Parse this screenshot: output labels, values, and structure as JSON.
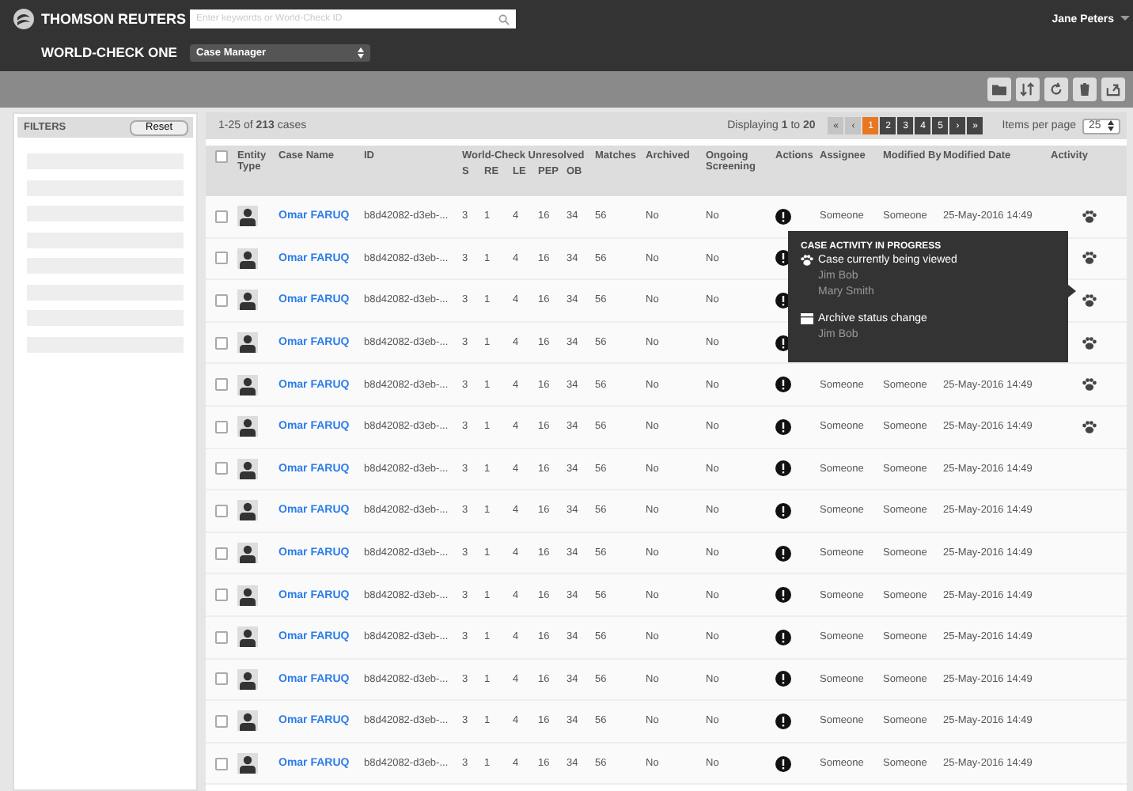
{
  "header": {
    "brand": "THOMSON REUTERS",
    "product": "WORLD-CHECK ONE",
    "search": {
      "placeholder": "Enter keywords or World-Check ID"
    },
    "module_select": "Case Manager",
    "user": "Jane Peters"
  },
  "filters": {
    "title": "FILTERS",
    "reset": "Reset"
  },
  "cases": {
    "summary": "1-25 of **213** cases",
    "displaying": "Displaying **1** to **20**",
    "pagination": [
      {
        "label": "«",
        "selected": false,
        "disabled": true
      },
      {
        "label": "‹",
        "selected": false,
        "disabled": true
      },
      {
        "label": "1",
        "selected": true,
        "disabled": false
      },
      {
        "label": "2",
        "selected": false,
        "disabled": false
      },
      {
        "label": "3",
        "selected": false,
        "disabled": false
      },
      {
        "label": "4",
        "selected": false,
        "disabled": false
      },
      {
        "label": "5",
        "selected": false,
        "disabled": false
      },
      {
        "label": "›",
        "selected": false,
        "disabled": false
      },
      {
        "label": "»",
        "selected": false,
        "disabled": false
      }
    ],
    "items_per_page": {
      "label": "Items per page",
      "value": "25"
    }
  },
  "table": {
    "select_all_checked": false,
    "columns": {
      "entity_type": "Entity Type",
      "case_name": "Case Name",
      "id": "ID",
      "world_check": "World-Check Unresolved",
      "sub": [
        "S",
        "RE",
        "LE",
        "PEP",
        "OB"
      ],
      "matches": "Matches",
      "archived": "Archived",
      "ongoing": "Ongoing Screening",
      "actions": "Actions",
      "assignee": "Assignee",
      "modified_by": "Modified By",
      "modified_date": "Modified Date",
      "activity": "Activity"
    },
    "rows": [
      {
        "checked": false,
        "name": "Omar FARUQ",
        "id": "b8d42082-d3eb-...",
        "counts": [
          "3",
          "1",
          "4",
          "16",
          "34"
        ],
        "matches": "56",
        "archived": "No",
        "ongoing": "No",
        "assignee": "Someone",
        "modified_by": "Someone",
        "modified_date": "25-May-2016 14:49",
        "activity": true
      },
      {
        "checked": false,
        "name": "Omar FARUQ",
        "id": "b8d42082-d3eb-...",
        "counts": [
          "3",
          "1",
          "4",
          "16",
          "34"
        ],
        "matches": "56",
        "archived": "No",
        "ongoing": "No",
        "activity": true
      },
      {
        "checked": false,
        "name": "Omar FARUQ",
        "id": "b8d42082-d3eb-...",
        "counts": [
          "3",
          "1",
          "4",
          "16",
          "34"
        ],
        "matches": "56",
        "archived": "No",
        "ongoing": "No",
        "activity": true
      },
      {
        "checked": false,
        "name": "Omar FARUQ",
        "id": "b8d42082-d3eb-...",
        "counts": [
          "3",
          "1",
          "4",
          "16",
          "34"
        ],
        "matches": "56",
        "archived": "No",
        "ongoing": "No",
        "activity": true
      },
      {
        "checked": false,
        "name": "Omar FARUQ",
        "id": "b8d42082-d3eb-...",
        "counts": [
          "3",
          "1",
          "4",
          "16",
          "34"
        ],
        "matches": "56",
        "archived": "No",
        "ongoing": "No",
        "assignee": "Someone",
        "modified_by": "Someone",
        "modified_date": "25-May-2016 14:49",
        "activity": true
      },
      {
        "checked": false,
        "name": "Omar FARUQ",
        "id": "b8d42082-d3eb-...",
        "counts": [
          "3",
          "1",
          "4",
          "16",
          "34"
        ],
        "matches": "56",
        "archived": "No",
        "ongoing": "No",
        "assignee": "Someone",
        "modified_by": "Someone",
        "modified_date": "25-May-2016 14:49",
        "activity": true
      },
      {
        "checked": false,
        "name": "Omar FARUQ",
        "id": "b8d42082-d3eb-...",
        "counts": [
          "3",
          "1",
          "4",
          "16",
          "34"
        ],
        "matches": "56",
        "archived": "No",
        "ongoing": "No",
        "assignee": "Someone",
        "modified_by": "Someone",
        "modified_date": "25-May-2016 14:49",
        "activity": false
      },
      {
        "checked": false,
        "name": "Omar FARUQ",
        "id": "b8d42082-d3eb-...",
        "counts": [
          "3",
          "1",
          "4",
          "16",
          "34"
        ],
        "matches": "56",
        "archived": "No",
        "ongoing": "No",
        "assignee": "Someone",
        "modified_by": "Someone",
        "modified_date": "25-May-2016 14:49",
        "activity": false
      },
      {
        "checked": false,
        "name": "Omar FARUQ",
        "id": "b8d42082-d3eb-...",
        "counts": [
          "3",
          "1",
          "4",
          "16",
          "34"
        ],
        "matches": "56",
        "archived": "No",
        "ongoing": "No",
        "assignee": "Someone",
        "modified_by": "Someone",
        "modified_date": "25-May-2016 14:49",
        "activity": false
      },
      {
        "checked": false,
        "name": "Omar FARUQ",
        "id": "b8d42082-d3eb-...",
        "counts": [
          "3",
          "1",
          "4",
          "16",
          "34"
        ],
        "matches": "56",
        "archived": "No",
        "ongoing": "No",
        "assignee": "Someone",
        "modified_by": "Someone",
        "modified_date": "25-May-2016 14:49",
        "activity": false
      },
      {
        "checked": false,
        "name": "Omar FARUQ",
        "id": "b8d42082-d3eb-...",
        "counts": [
          "3",
          "1",
          "4",
          "16",
          "34"
        ],
        "matches": "56",
        "archived": "No",
        "ongoing": "No",
        "assignee": "Someone",
        "modified_by": "Someone",
        "modified_date": "25-May-2016 14:49",
        "activity": false
      },
      {
        "checked": false,
        "name": "Omar FARUQ",
        "id": "b8d42082-d3eb-...",
        "counts": [
          "3",
          "1",
          "4",
          "16",
          "34"
        ],
        "matches": "56",
        "archived": "No",
        "ongoing": "No",
        "assignee": "Someone",
        "modified_by": "Someone",
        "modified_date": "25-May-2016 14:49",
        "activity": false
      },
      {
        "checked": false,
        "name": "Omar FARUQ",
        "id": "b8d42082-d3eb-...",
        "counts": [
          "3",
          "1",
          "4",
          "16",
          "34"
        ],
        "matches": "56",
        "archived": "No",
        "ongoing": "No",
        "assignee": "Someone",
        "modified_by": "Someone",
        "modified_date": "25-May-2016 14:49",
        "activity": false
      },
      {
        "checked": false,
        "name": "Omar FARUQ",
        "id": "b8d42082-d3eb-...",
        "counts": [
          "3",
          "1",
          "4",
          "16",
          "34"
        ],
        "matches": "56",
        "archived": "No",
        "ongoing": "No",
        "assignee": "Someone",
        "modified_by": "Someone",
        "modified_date": "25-May-2016 14:49",
        "activity": false
      }
    ]
  },
  "tooltip": {
    "title": "CASE ACTIVITY IN PROGRESS",
    "sections": [
      {
        "kind": "viewing",
        "label": "Case currently being viewed",
        "users": [
          "Jim Bob",
          "Mary Smith"
        ]
      },
      {
        "kind": "archive",
        "label": "Archive status change",
        "users": [
          "Jim Bob"
        ]
      }
    ]
  }
}
